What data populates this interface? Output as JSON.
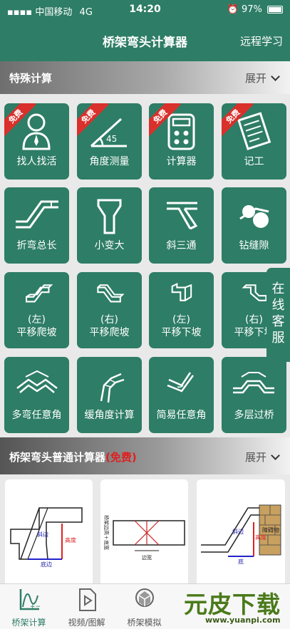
{
  "status_bar": {
    "carrier": "中国移动",
    "network": "4G",
    "time": "14:20",
    "battery": "97%"
  },
  "nav": {
    "title": "桥架弯头计算器",
    "right_action": "远程学习"
  },
  "special_section": {
    "title": "特殊计算",
    "expand": "展开"
  },
  "free_badge": "免费",
  "tiles": [
    {
      "label": "找人找活",
      "icon": "worker-icon",
      "free": true
    },
    {
      "label": "角度测量",
      "icon": "angle-icon",
      "free": true,
      "angle_text": "45"
    },
    {
      "label": "计算器",
      "icon": "calculator-icon",
      "free": true
    },
    {
      "label": "记工",
      "icon": "notebook-icon",
      "free": true
    },
    {
      "label": "折弯总长",
      "icon": "bend-length-icon"
    },
    {
      "label": "小变大",
      "icon": "reducer-icon"
    },
    {
      "label": "斜三通",
      "icon": "tee-icon"
    },
    {
      "label": "钻缝隙",
      "icon": "gap-icon"
    },
    {
      "line1": "(左)",
      "line2": "平移爬坡",
      "icon": "left-shift-climb-icon"
    },
    {
      "line1": "(右)",
      "line2": "平移爬坡",
      "icon": "right-shift-climb-icon"
    },
    {
      "line1": "(左)",
      "line2": "平移下坡",
      "icon": "left-shift-down-icon"
    },
    {
      "line1": "(右)",
      "line2": "平移下坡",
      "icon": "right-shift-down-icon"
    },
    {
      "label": "多弯任意角",
      "icon": "multi-bend-icon"
    },
    {
      "label": "缓角度计算",
      "icon": "gentle-angle-icon"
    },
    {
      "label": "简易任意角",
      "icon": "simple-angle-icon"
    },
    {
      "label": "多层过桥",
      "icon": "bridge-icon"
    }
  ],
  "online_service": "在线客服",
  "normal_section": {
    "title": "桥架弯头普通计算器",
    "free_tag": "(免费)",
    "expand": "展开"
  },
  "cards": [
    {
      "labels": [
        "斜边",
        "底边",
        "高度"
      ]
    },
    {
      "labels": [
        "桥架边高＋底宽",
        "边宽"
      ]
    },
    {
      "labels": [
        "斜边",
        "底",
        "高度",
        "障碍物"
      ]
    }
  ],
  "tabs": [
    {
      "label": "桥架计算",
      "active": true
    },
    {
      "label": "视频/图解"
    },
    {
      "label": "桥架模拟"
    }
  ],
  "watermark": {
    "text": "元皮下载",
    "url": "www.yuanpi.com"
  },
  "colors": {
    "primary": "#2e7d66",
    "ribbon": "#d9302c",
    "free_text": "#e02020"
  }
}
